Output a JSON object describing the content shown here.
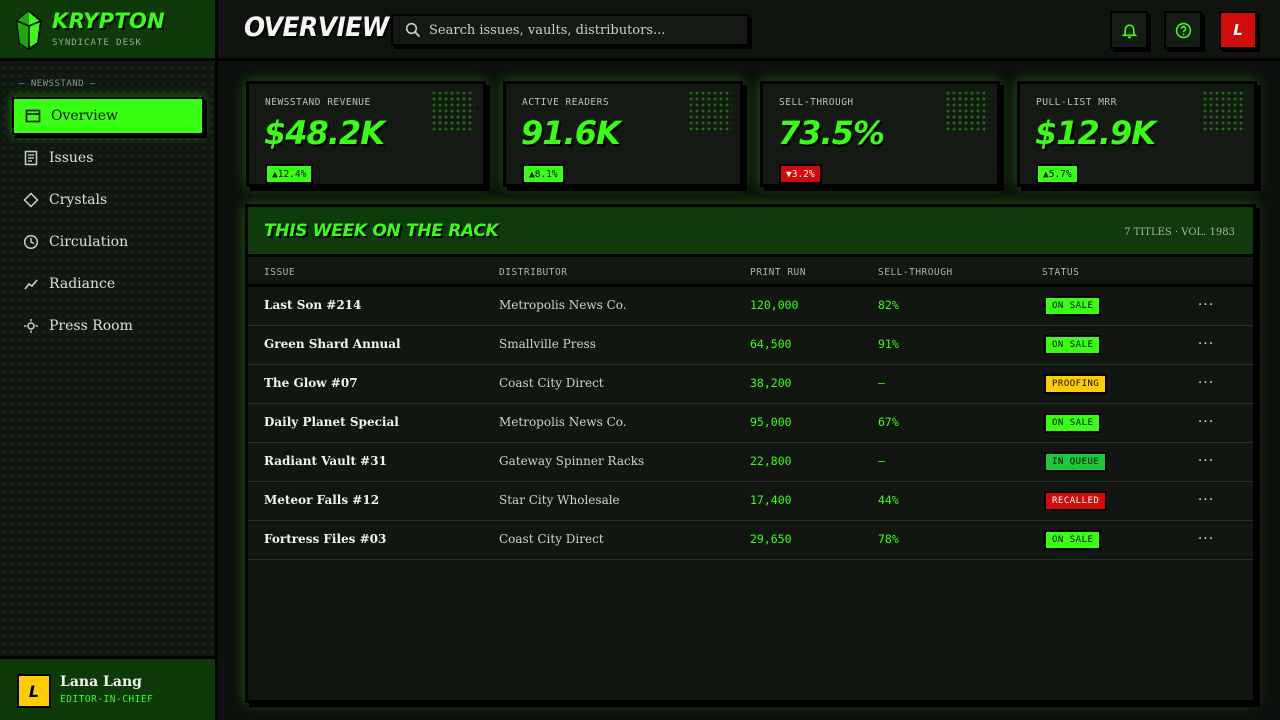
{
  "brand": {
    "name": "KRYPTON",
    "subtitle": "SYNDICATE DESK",
    "accent": "#39ff14"
  },
  "sidebar": {
    "section_label": "— NEWSSTAND —",
    "items": [
      {
        "label": "Overview",
        "icon": "layout-icon",
        "active": true
      },
      {
        "label": "Issues",
        "icon": "document-icon",
        "active": false
      },
      {
        "label": "Crystals",
        "icon": "diamond-icon",
        "active": false
      },
      {
        "label": "Circulation",
        "icon": "clock-icon",
        "active": false
      },
      {
        "label": "Radiance",
        "icon": "trend-line-icon",
        "active": false
      },
      {
        "label": "Press Room",
        "icon": "sun-icon",
        "active": false
      }
    ]
  },
  "user": {
    "initial": "L",
    "name": "Lana Lang",
    "role": "EDITOR-IN-CHIEF"
  },
  "topbar": {
    "title": "OVERVIEW",
    "search_placeholder": "Search issues, vaults, distributors...",
    "profile_initial": "L"
  },
  "kpis": [
    {
      "label": "NEWSSTAND REVENUE",
      "value": "$48.2K",
      "delta": "▲12.4%",
      "trend": "up"
    },
    {
      "label": "ACTIVE READERS",
      "value": "91.6K",
      "delta": "▲8.1%",
      "trend": "up"
    },
    {
      "label": "SELL-THROUGH",
      "value": "73.5%",
      "delta": "▼3.2%",
      "trend": "down"
    },
    {
      "label": "PULL-LIST MRR",
      "value": "$12.9K",
      "delta": "▲5.7%",
      "trend": "up"
    }
  ],
  "table": {
    "title": "THIS WEEK ON THE RACK",
    "meta": "7 TITLES · VOL. 1983",
    "headers": [
      "ISSUE",
      "DISTRIBUTOR",
      "PRINT RUN",
      "SELL-THROUGH",
      "STATUS"
    ],
    "rows": [
      {
        "issue": "Last Son #214",
        "distributor": "Metropolis News Co.",
        "print_run": "120,000",
        "sell_through": "82%",
        "status": "ON SALE",
        "status_color": "green"
      },
      {
        "issue": "Green Shard Annual",
        "distributor": "Smallville Press",
        "print_run": "64,500",
        "sell_through": "91%",
        "status": "ON SALE",
        "status_color": "green"
      },
      {
        "issue": "The Glow #07",
        "distributor": "Coast City Direct",
        "print_run": "38,200",
        "sell_through": "—",
        "status": "PROOFING",
        "status_color": "yellow"
      },
      {
        "issue": "Daily Planet Special",
        "distributor": "Metropolis News Co.",
        "print_run": "95,000",
        "sell_through": "67%",
        "status": "ON SALE",
        "status_color": "green"
      },
      {
        "issue": "Radiant Vault #31",
        "distributor": "Gateway Spinner Racks",
        "print_run": "22,800",
        "sell_through": "—",
        "status": "IN QUEUE",
        "status_color": "queue"
      },
      {
        "issue": "Meteor Falls #12",
        "distributor": "Star City Wholesale",
        "print_run": "17,400",
        "sell_through": "44%",
        "status": "RECALLED",
        "status_color": "red"
      },
      {
        "issue": "Fortress Files #03",
        "distributor": "Coast City Direct",
        "print_run": "29,650",
        "sell_through": "78%",
        "status": "ON SALE",
        "status_color": "green"
      }
    ],
    "row_action_label": "···"
  }
}
